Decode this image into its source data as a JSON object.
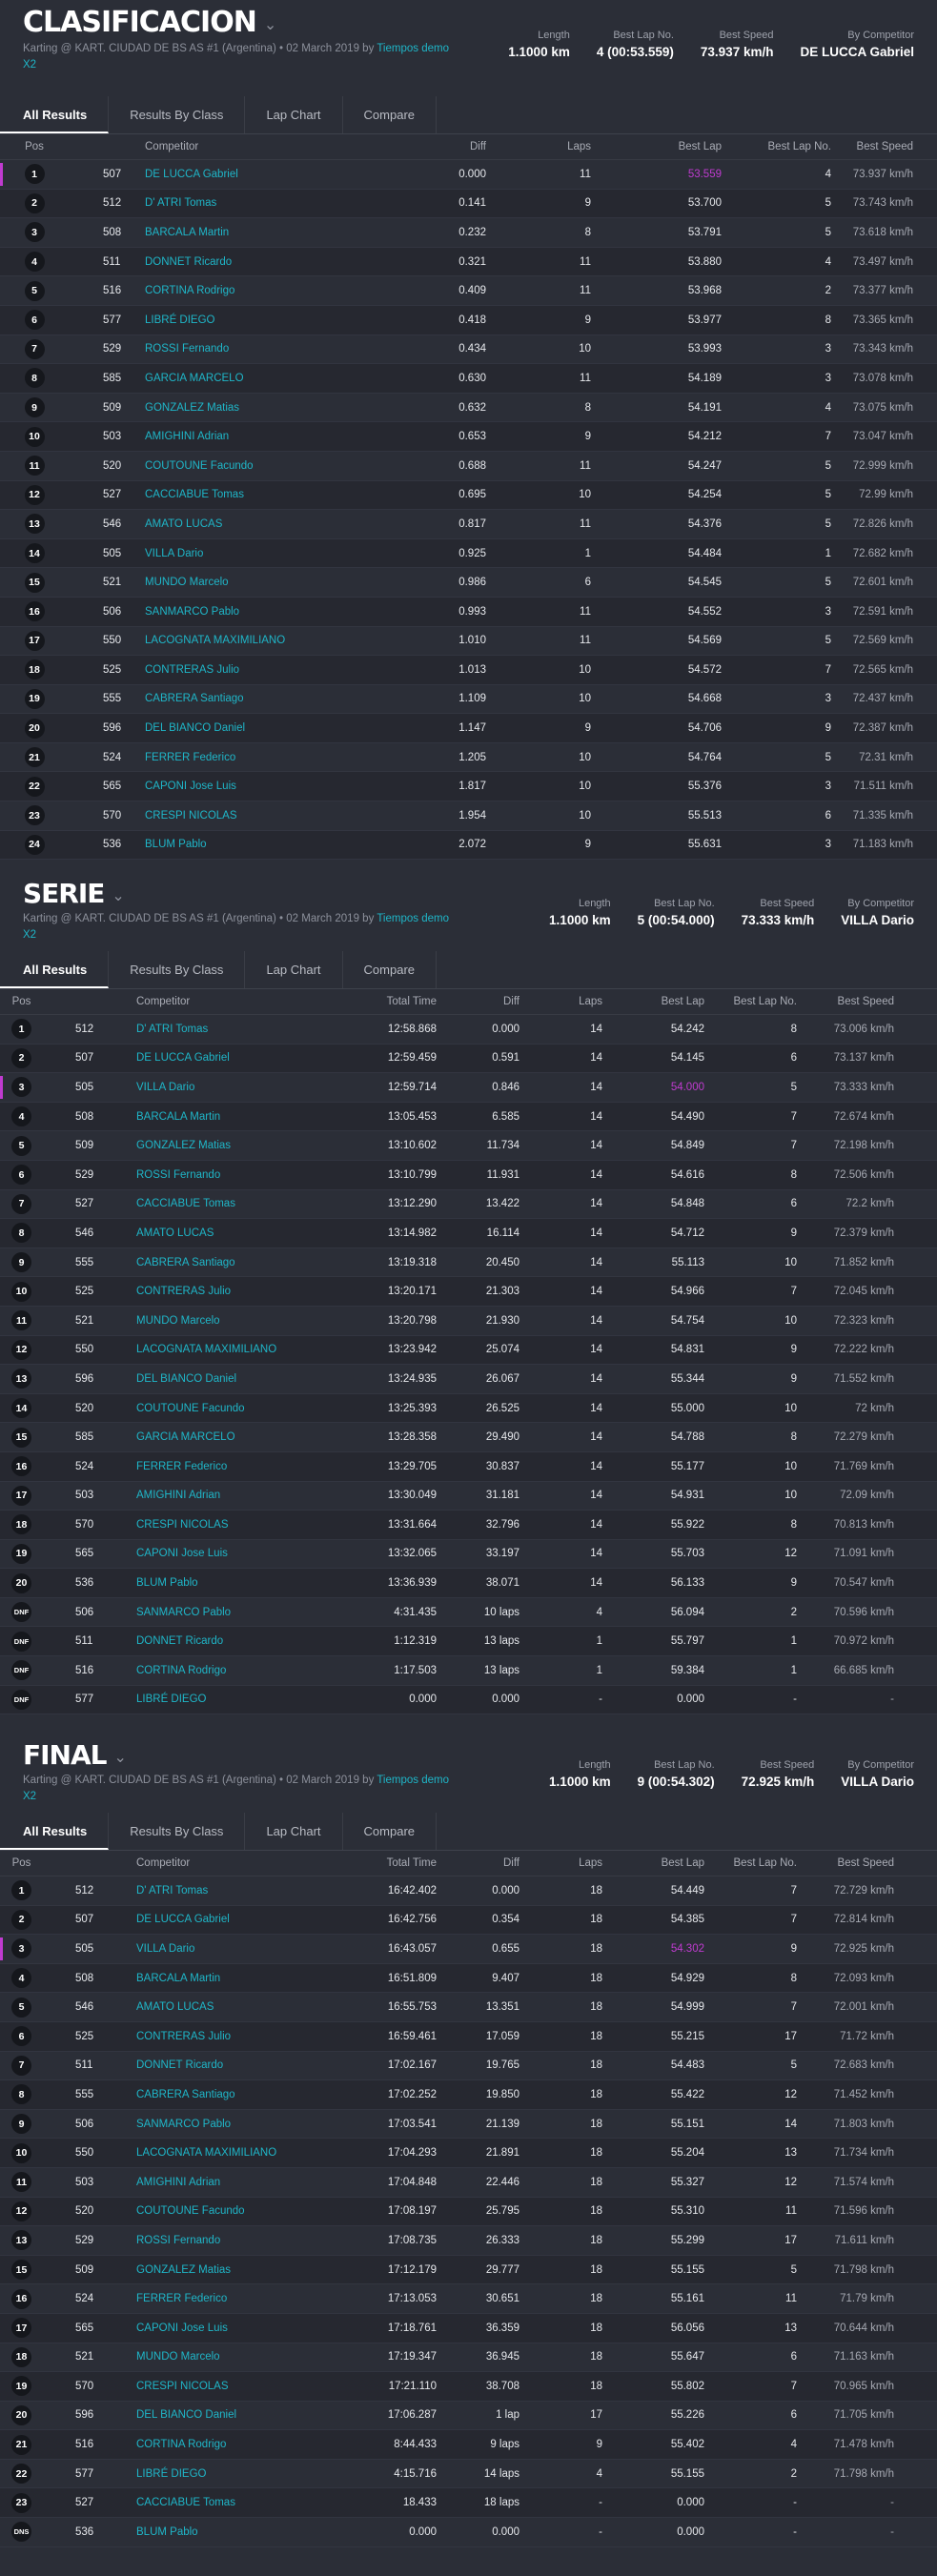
{
  "colors": {
    "accent": "#1fb6c8",
    "best_lap_highlight": "#c03bd0",
    "background": "#2b2e37"
  },
  "title_chevron_icon": "chevron-down-icon",
  "sections": [
    {
      "title": "CLASIFICACION",
      "subtitle": "Karting @ KART. CIUDAD DE BS AS #1 (Argentina) • 02 March 2019 by",
      "link": "Tiempos demo X2",
      "stats": [
        {
          "label": "Length",
          "value": "1.1000 km"
        },
        {
          "label": "Best Lap No.",
          "value": "4 (00:53.559)"
        },
        {
          "label": "Best Speed",
          "value": "73.937 km/h"
        },
        {
          "label": "By Competitor",
          "value": "DE LUCCA Gabriel"
        }
      ],
      "tabs": [
        "All Results",
        "Results By Class",
        "Lap Chart",
        "Compare"
      ],
      "headers": [
        "Pos",
        "",
        "Competitor",
        "Diff",
        "Laps",
        "Best Lap",
        "Best Lap No.",
        "Best Speed"
      ],
      "rows": [
        [
          "1",
          "507",
          "DE LUCCA Gabriel",
          "0.000",
          "11",
          "53.559",
          "4",
          "73.937 km/h"
        ],
        [
          "2",
          "512",
          "D' ATRI Tomas",
          "0.141",
          "9",
          "53.700",
          "5",
          "73.743 km/h"
        ],
        [
          "3",
          "508",
          "BARCALA Martin",
          "0.232",
          "8",
          "53.791",
          "5",
          "73.618 km/h"
        ],
        [
          "4",
          "511",
          "DONNET Ricardo",
          "0.321",
          "11",
          "53.880",
          "4",
          "73.497 km/h"
        ],
        [
          "5",
          "516",
          "CORTINA Rodrigo",
          "0.409",
          "11",
          "53.968",
          "2",
          "73.377 km/h"
        ],
        [
          "6",
          "577",
          "LIBRÉ DIEGO",
          "0.418",
          "9",
          "53.977",
          "8",
          "73.365 km/h"
        ],
        [
          "7",
          "529",
          "ROSSI Fernando",
          "0.434",
          "10",
          "53.993",
          "3",
          "73.343 km/h"
        ],
        [
          "8",
          "585",
          "GARCIA MARCELO",
          "0.630",
          "11",
          "54.189",
          "3",
          "73.078 km/h"
        ],
        [
          "9",
          "509",
          "GONZALEZ Matias",
          "0.632",
          "8",
          "54.191",
          "4",
          "73.075 km/h"
        ],
        [
          "10",
          "503",
          "AMIGHINI Adrian",
          "0.653",
          "9",
          "54.212",
          "7",
          "73.047 km/h"
        ],
        [
          "11",
          "520",
          "COUTOUNE Facundo",
          "0.688",
          "11",
          "54.247",
          "5",
          "72.999 km/h"
        ],
        [
          "12",
          "527",
          "CACCIABUE Tomas",
          "0.695",
          "10",
          "54.254",
          "5",
          "72.99 km/h"
        ],
        [
          "13",
          "546",
          "AMATO LUCAS",
          "0.817",
          "11",
          "54.376",
          "5",
          "72.826 km/h"
        ],
        [
          "14",
          "505",
          "VILLA Dario",
          "0.925",
          "1",
          "54.484",
          "1",
          "72.682 km/h"
        ],
        [
          "15",
          "521",
          "MUNDO Marcelo",
          "0.986",
          "6",
          "54.545",
          "5",
          "72.601 km/h"
        ],
        [
          "16",
          "506",
          "SANMARCO Pablo",
          "0.993",
          "11",
          "54.552",
          "3",
          "72.591 km/h"
        ],
        [
          "17",
          "550",
          "LACOGNATA MAXIMILIANO",
          "1.010",
          "11",
          "54.569",
          "5",
          "72.569 km/h"
        ],
        [
          "18",
          "525",
          "CONTRERAS Julio",
          "1.013",
          "10",
          "54.572",
          "7",
          "72.565 km/h"
        ],
        [
          "19",
          "555",
          "CABRERA Santiago",
          "1.109",
          "10",
          "54.668",
          "3",
          "72.437 km/h"
        ],
        [
          "20",
          "596",
          "DEL BIANCO Daniel",
          "1.147",
          "9",
          "54.706",
          "9",
          "72.387 km/h"
        ],
        [
          "21",
          "524",
          "FERRER Federico",
          "1.205",
          "10",
          "54.764",
          "5",
          "72.31 km/h"
        ],
        [
          "22",
          "565",
          "CAPONI Jose Luis",
          "1.817",
          "10",
          "55.376",
          "3",
          "71.511 km/h"
        ],
        [
          "23",
          "570",
          "CRESPI NICOLAS",
          "1.954",
          "10",
          "55.513",
          "6",
          "71.335 km/h"
        ],
        [
          "24",
          "536",
          "BLUM Pablo",
          "2.072",
          "9",
          "55.631",
          "3",
          "71.183 km/h"
        ]
      ]
    },
    {
      "title": "SERIE",
      "subtitle": "Karting @ KART. CIUDAD DE BS AS #1 (Argentina) • 02 March 2019 by",
      "link": "Tiempos demo X2",
      "stats": [
        {
          "label": "Length",
          "value": "1.1000 km"
        },
        {
          "label": "Best Lap No.",
          "value": "5 (00:54.000)"
        },
        {
          "label": "Best Speed",
          "value": "73.333 km/h"
        },
        {
          "label": "By Competitor",
          "value": "VILLA Dario"
        }
      ],
      "tabs": [
        "All Results",
        "Results By Class",
        "Lap Chart",
        "Compare"
      ],
      "headers": [
        "Pos",
        "",
        "Competitor",
        "Total Time",
        "Diff",
        "Laps",
        "Best Lap",
        "Best Lap No.",
        "Best Speed"
      ],
      "rows": [
        [
          "1",
          "512",
          "D' ATRI Tomas",
          "12:58.868",
          "0.000",
          "14",
          "54.242",
          "8",
          "73.006 km/h"
        ],
        [
          "2",
          "507",
          "DE LUCCA Gabriel",
          "12:59.459",
          "0.591",
          "14",
          "54.145",
          "6",
          "73.137 km/h"
        ],
        [
          "3",
          "505",
          "VILLA Dario",
          "12:59.714",
          "0.846",
          "14",
          "54.000",
          "5",
          "73.333 km/h"
        ],
        [
          "4",
          "508",
          "BARCALA Martin",
          "13:05.453",
          "6.585",
          "14",
          "54.490",
          "7",
          "72.674 km/h"
        ],
        [
          "5",
          "509",
          "GONZALEZ Matias",
          "13:10.602",
          "11.734",
          "14",
          "54.849",
          "7",
          "72.198 km/h"
        ],
        [
          "6",
          "529",
          "ROSSI Fernando",
          "13:10.799",
          "11.931",
          "14",
          "54.616",
          "8",
          "72.506 km/h"
        ],
        [
          "7",
          "527",
          "CACCIABUE Tomas",
          "13:12.290",
          "13.422",
          "14",
          "54.848",
          "6",
          "72.2 km/h"
        ],
        [
          "8",
          "546",
          "AMATO LUCAS",
          "13:14.982",
          "16.114",
          "14",
          "54.712",
          "9",
          "72.379 km/h"
        ],
        [
          "9",
          "555",
          "CABRERA Santiago",
          "13:19.318",
          "20.450",
          "14",
          "55.113",
          "10",
          "71.852 km/h"
        ],
        [
          "10",
          "525",
          "CONTRERAS Julio",
          "13:20.171",
          "21.303",
          "14",
          "54.966",
          "7",
          "72.045 km/h"
        ],
        [
          "11",
          "521",
          "MUNDO Marcelo",
          "13:20.798",
          "21.930",
          "14",
          "54.754",
          "10",
          "72.323 km/h"
        ],
        [
          "12",
          "550",
          "LACOGNATA MAXIMILIANO",
          "13:23.942",
          "25.074",
          "14",
          "54.831",
          "9",
          "72.222 km/h"
        ],
        [
          "13",
          "596",
          "DEL BIANCO Daniel",
          "13:24.935",
          "26.067",
          "14",
          "55.344",
          "9",
          "71.552 km/h"
        ],
        [
          "14",
          "520",
          "COUTOUNE Facundo",
          "13:25.393",
          "26.525",
          "14",
          "55.000",
          "10",
          "72 km/h"
        ],
        [
          "15",
          "585",
          "GARCIA MARCELO",
          "13:28.358",
          "29.490",
          "14",
          "54.788",
          "8",
          "72.279 km/h"
        ],
        [
          "16",
          "524",
          "FERRER Federico",
          "13:29.705",
          "30.837",
          "14",
          "55.177",
          "10",
          "71.769 km/h"
        ],
        [
          "17",
          "503",
          "AMIGHINI Adrian",
          "13:30.049",
          "31.181",
          "14",
          "54.931",
          "10",
          "72.09 km/h"
        ],
        [
          "18",
          "570",
          "CRESPI NICOLAS",
          "13:31.664",
          "32.796",
          "14",
          "55.922",
          "8",
          "70.813 km/h"
        ],
        [
          "19",
          "565",
          "CAPONI Jose Luis",
          "13:32.065",
          "33.197",
          "14",
          "55.703",
          "12",
          "71.091 km/h"
        ],
        [
          "20",
          "536",
          "BLUM Pablo",
          "13:36.939",
          "38.071",
          "14",
          "56.133",
          "9",
          "70.547 km/h"
        ],
        [
          "DNF",
          "506",
          "SANMARCO Pablo",
          "4:31.435",
          "10 laps",
          "4",
          "56.094",
          "2",
          "70.596 km/h"
        ],
        [
          "DNF",
          "511",
          "DONNET Ricardo",
          "1:12.319",
          "13 laps",
          "1",
          "55.797",
          "1",
          "70.972 km/h"
        ],
        [
          "DNF",
          "516",
          "CORTINA Rodrigo",
          "1:17.503",
          "13 laps",
          "1",
          "59.384",
          "1",
          "66.685 km/h"
        ],
        [
          "DNF",
          "577",
          "LIBRÉ DIEGO",
          "0.000",
          "0.000",
          "-",
          "0.000",
          "-",
          "-"
        ]
      ]
    },
    {
      "title": "FINAL",
      "subtitle": "Karting @ KART. CIUDAD DE BS AS #1 (Argentina) • 02 March 2019 by",
      "link": "Tiempos demo X2",
      "stats": [
        {
          "label": "Length",
          "value": "1.1000 km"
        },
        {
          "label": "Best Lap No.",
          "value": "9 (00:54.302)"
        },
        {
          "label": "Best Speed",
          "value": "72.925 km/h"
        },
        {
          "label": "By Competitor",
          "value": "VILLA Dario"
        }
      ],
      "tabs": [
        "All Results",
        "Results By Class",
        "Lap Chart",
        "Compare"
      ],
      "headers": [
        "Pos",
        "",
        "Competitor",
        "Total Time",
        "Diff",
        "Laps",
        "Best Lap",
        "Best Lap No.",
        "Best Speed"
      ],
      "rows": [
        [
          "1",
          "512",
          "D' ATRI Tomas",
          "16:42.402",
          "0.000",
          "18",
          "54.449",
          "7",
          "72.729 km/h"
        ],
        [
          "2",
          "507",
          "DE LUCCA Gabriel",
          "16:42.756",
          "0.354",
          "18",
          "54.385",
          "7",
          "72.814 km/h"
        ],
        [
          "3",
          "505",
          "VILLA Dario",
          "16:43.057",
          "0.655",
          "18",
          "54.302",
          "9",
          "72.925 km/h"
        ],
        [
          "4",
          "508",
          "BARCALA Martin",
          "16:51.809",
          "9.407",
          "18",
          "54.929",
          "8",
          "72.093 km/h"
        ],
        [
          "5",
          "546",
          "AMATO LUCAS",
          "16:55.753",
          "13.351",
          "18",
          "54.999",
          "7",
          "72.001 km/h"
        ],
        [
          "6",
          "525",
          "CONTRERAS Julio",
          "16:59.461",
          "17.059",
          "18",
          "55.215",
          "17",
          "71.72 km/h"
        ],
        [
          "7",
          "511",
          "DONNET Ricardo",
          "17:02.167",
          "19.765",
          "18",
          "54.483",
          "5",
          "72.683 km/h"
        ],
        [
          "8",
          "555",
          "CABRERA Santiago",
          "17:02.252",
          "19.850",
          "18",
          "55.422",
          "12",
          "71.452 km/h"
        ],
        [
          "9",
          "506",
          "SANMARCO Pablo",
          "17:03.541",
          "21.139",
          "18",
          "55.151",
          "14",
          "71.803 km/h"
        ],
        [
          "10",
          "550",
          "LACOGNATA MAXIMILIANO",
          "17:04.293",
          "21.891",
          "18",
          "55.204",
          "13",
          "71.734 km/h"
        ],
        [
          "11",
          "503",
          "AMIGHINI Adrian",
          "17:04.848",
          "22.446",
          "18",
          "55.327",
          "12",
          "71.574 km/h"
        ],
        [
          "12",
          "520",
          "COUTOUNE Facundo",
          "17:08.197",
          "25.795",
          "18",
          "55.310",
          "11",
          "71.596 km/h"
        ],
        [
          "13",
          "529",
          "ROSSI Fernando",
          "17:08.735",
          "26.333",
          "18",
          "55.299",
          "17",
          "71.611 km/h"
        ],
        [
          "15",
          "509",
          "GONZALEZ Matias",
          "17:12.179",
          "29.777",
          "18",
          "55.155",
          "5",
          "71.798 km/h"
        ],
        [
          "16",
          "524",
          "FERRER Federico",
          "17:13.053",
          "30.651",
          "18",
          "55.161",
          "11",
          "71.79 km/h"
        ],
        [
          "17",
          "565",
          "CAPONI Jose Luis",
          "17:18.761",
          "36.359",
          "18",
          "56.056",
          "13",
          "70.644 km/h"
        ],
        [
          "18",
          "521",
          "MUNDO Marcelo",
          "17:19.347",
          "36.945",
          "18",
          "55.647",
          "6",
          "71.163 km/h"
        ],
        [
          "19",
          "570",
          "CRESPI NICOLAS",
          "17:21.110",
          "38.708",
          "18",
          "55.802",
          "7",
          "70.965 km/h"
        ],
        [
          "20",
          "596",
          "DEL BIANCO Daniel",
          "17:06.287",
          "1 lap",
          "17",
          "55.226",
          "6",
          "71.705 km/h"
        ],
        [
          "21",
          "516",
          "CORTINA Rodrigo",
          "8:44.433",
          "9 laps",
          "9",
          "55.402",
          "4",
          "71.478 km/h"
        ],
        [
          "22",
          "577",
          "LIBRÉ DIEGO",
          "4:15.716",
          "14 laps",
          "4",
          "55.155",
          "2",
          "71.798 km/h"
        ],
        [
          "23",
          "527",
          "CACCIABUE Tomas",
          "18.433",
          "18 laps",
          "-",
          "0.000",
          "-",
          "-"
        ],
        [
          "DNS",
          "536",
          "BLUM Pablo",
          "0.000",
          "0.000",
          "-",
          "0.000",
          "-",
          "-"
        ]
      ]
    }
  ]
}
